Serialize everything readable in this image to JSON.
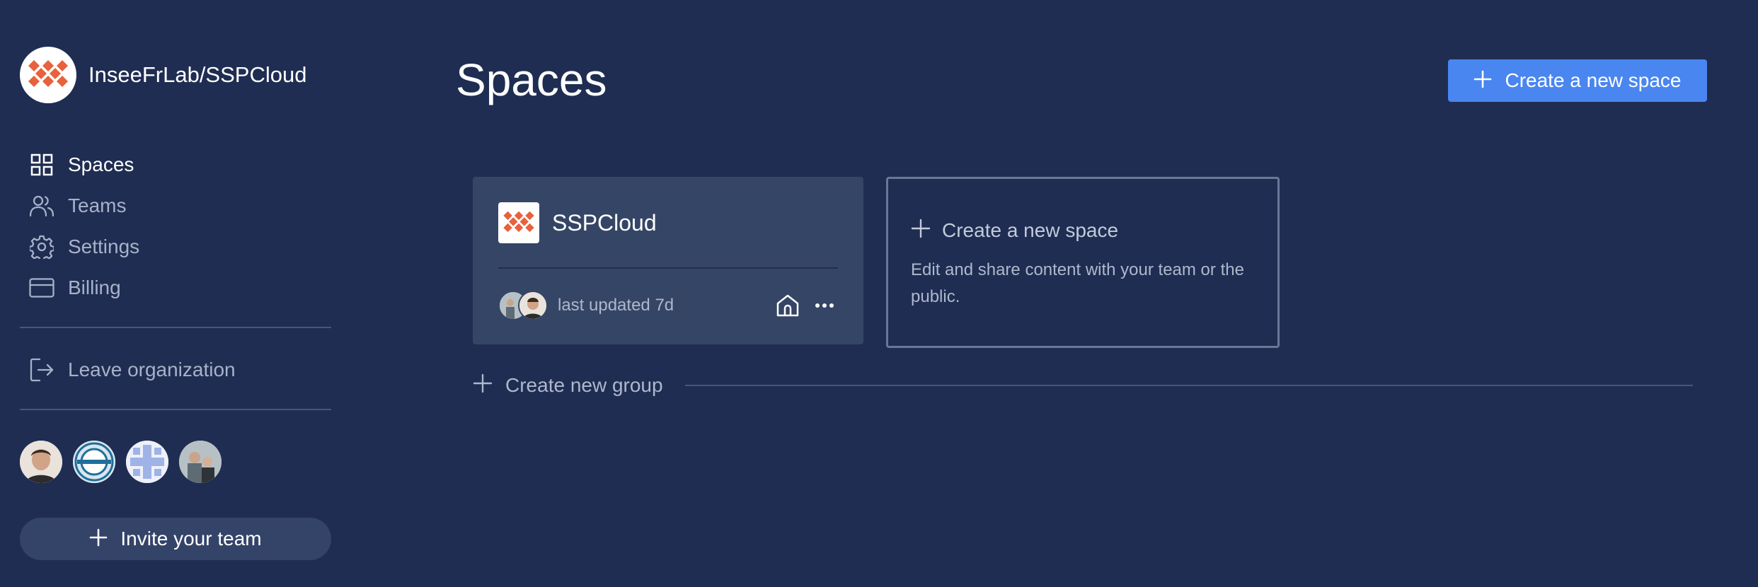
{
  "org": {
    "name": "InseeFrLab/SSPCloud",
    "logo_icon": "diamond-grid-logo",
    "logo_color": "#e8613c"
  },
  "sidebar": {
    "items": [
      {
        "label": "Spaces",
        "icon": "grid-icon",
        "active": true
      },
      {
        "label": "Teams",
        "icon": "users-icon",
        "active": false
      },
      {
        "label": "Settings",
        "icon": "gear-icon",
        "active": false
      },
      {
        "label": "Billing",
        "icon": "credit-card-icon",
        "active": false
      }
    ],
    "leave_label": "Leave organization",
    "invite_label": "Invite your team"
  },
  "main": {
    "title": "Spaces",
    "create_button_label": "Create a new space",
    "space_card": {
      "name": "SSPCloud",
      "updated": "last updated 7d"
    },
    "new_space_card": {
      "title": "Create a new space",
      "description": "Edit and share content with your team or the public."
    },
    "create_group_label": "Create new group"
  },
  "colors": {
    "background": "#1f2d52",
    "accent": "#4a86f0",
    "card": "#354565",
    "brand": "#e8613c"
  }
}
